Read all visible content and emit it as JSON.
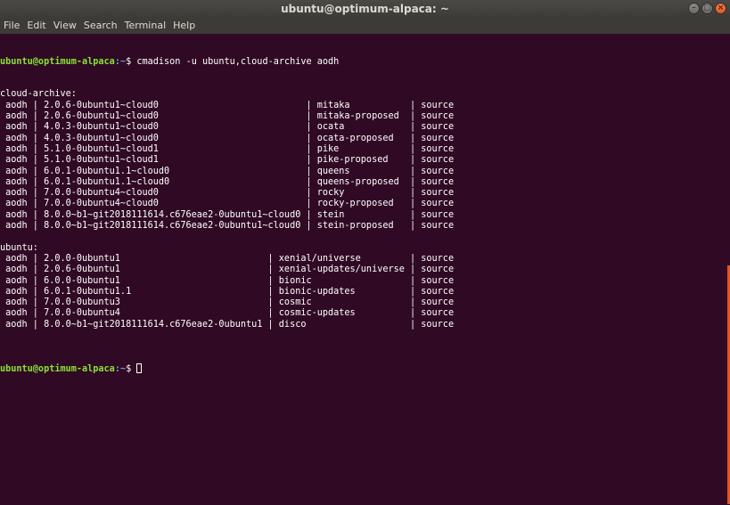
{
  "window": {
    "title": "ubuntu@optimum-alpaca: ~",
    "controls": [
      "minimize",
      "maximize",
      "close"
    ]
  },
  "menu": [
    "File",
    "Edit",
    "View",
    "Search",
    "Terminal",
    "Help"
  ],
  "terminal": {
    "prompt_user": "ubuntu@optimum-alpaca",
    "prompt_path": ":~",
    "prompt_symbol": "$ ",
    "command": "cmadison -u ubuntu,cloud-archive aodh",
    "output": [
      "cloud-archive:",
      " aodh | 2.0.6-0ubuntu1~cloud0                           | mitaka           | source",
      " aodh | 2.0.6-0ubuntu1~cloud0                           | mitaka-proposed  | source",
      " aodh | 4.0.3-0ubuntu1~cloud0                           | ocata            | source",
      " aodh | 4.0.3-0ubuntu1~cloud0                           | ocata-proposed   | source",
      " aodh | 5.1.0-0ubuntu1~cloud1                           | pike             | source",
      " aodh | 5.1.0-0ubuntu1~cloud1                           | pike-proposed    | source",
      " aodh | 6.0.1-0ubuntu1.1~cloud0                         | queens           | source",
      " aodh | 6.0.1-0ubuntu1.1~cloud0                         | queens-proposed  | source",
      " aodh | 7.0.0-0ubuntu4~cloud0                           | rocky            | source",
      " aodh | 7.0.0-0ubuntu4~cloud0                           | rocky-proposed   | source",
      " aodh | 8.0.0~b1~git2018111614.c676eae2-0ubuntu1~cloud0 | stein            | source",
      " aodh | 8.0.0~b1~git2018111614.c676eae2-0ubuntu1~cloud0 | stein-proposed   | source",
      "",
      "ubuntu:",
      " aodh | 2.0.0-0ubuntu1                           | xenial/universe         | source",
      " aodh | 2.0.6-0ubuntu1                           | xenial-updates/universe | source",
      " aodh | 6.0.0-0ubuntu1                           | bionic                  | source",
      " aodh | 6.0.1-0ubuntu1.1                         | bionic-updates          | source",
      " aodh | 7.0.0-0ubuntu3                           | cosmic                  | source",
      " aodh | 7.0.0-0ubuntu4                           | cosmic-updates          | source",
      " aodh | 8.0.0~b1~git2018111614.c676eae2-0ubuntu1 | disco                   | source",
      ""
    ]
  },
  "colors": {
    "background": "#300a24",
    "prompt_user": "#8ae234",
    "prompt_path": "#729fcf",
    "scrollbar": "#e95420"
  }
}
